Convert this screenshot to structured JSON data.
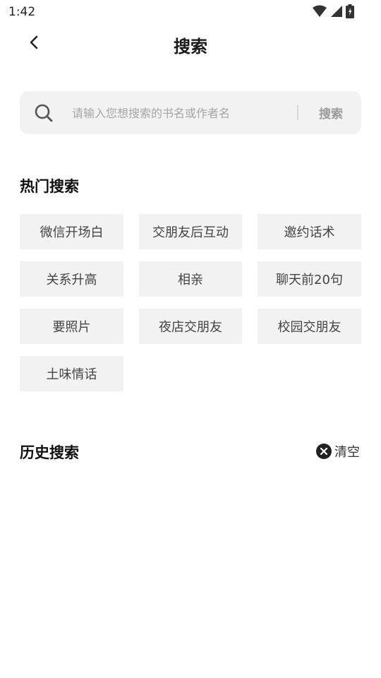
{
  "status_bar": {
    "time": "1:42"
  },
  "nav": {
    "title": "搜索"
  },
  "search": {
    "placeholder": "请输入您想搜索的书名或作者名",
    "button_label": "搜索"
  },
  "hot_search": {
    "title": "热门搜索",
    "tags": [
      "微信开场白",
      "交朋友后互动",
      "邀约话术",
      "关系升高",
      "相亲",
      "聊天前20句",
      "要照片",
      "夜店交朋友",
      "校园交朋友",
      "土味情话"
    ]
  },
  "history": {
    "title": "历史搜索",
    "clear_label": "清空"
  }
}
